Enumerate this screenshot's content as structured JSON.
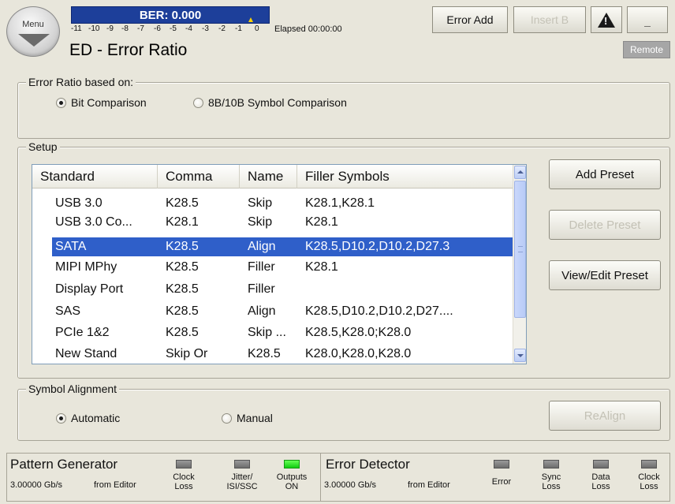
{
  "header": {
    "menu_label": "Menu",
    "ber_label": "BER: 0.000",
    "scale_ticks": [
      "-11",
      "-10",
      "-9",
      "-8",
      "-7",
      "-6",
      "-5",
      "-4",
      "-3",
      "-2",
      "-1",
      "0"
    ],
    "elapsed": "Elapsed 00:00:00",
    "title": "ED - Error Ratio",
    "error_add_label": "Error Add",
    "insert_b_label": "Insert B",
    "minimize_label": "_",
    "remote_label": "Remote",
    "warning_icon": "warning-icon"
  },
  "error_ratio": {
    "legend": "Error Ratio based on:",
    "options": [
      {
        "label": "Bit Comparison",
        "checked": true
      },
      {
        "label": "8B/10B Symbol Comparison",
        "checked": false
      }
    ]
  },
  "setup": {
    "legend": "Setup",
    "columns": [
      "Standard",
      "Comma",
      "Name",
      "Filler Symbols"
    ],
    "rows": [
      {
        "standard": "USB 3.0",
        "comma": "K28.5",
        "name": "Skip",
        "filler": "K28.1,K28.1",
        "selected": false
      },
      {
        "standard": "USB 3.0 Co...",
        "comma": "K28.1",
        "name": "Skip",
        "filler": "K28.1",
        "selected": false
      },
      {
        "standard": "SATA",
        "comma": "K28.5",
        "name": "Align",
        "filler": "K28.5,D10.2,D10.2,D27.3",
        "selected": true
      },
      {
        "standard": "MIPI MPhy",
        "comma": "K28.5",
        "name": "Filler",
        "filler": "K28.1",
        "selected": false
      },
      {
        "standard": "Display Port",
        "comma": "K28.5",
        "name": "Filler",
        "filler": "",
        "selected": false
      },
      {
        "standard": "SAS",
        "comma": "K28.5",
        "name": "Align",
        "filler": "K28.5,D10.2,D10.2,D27....",
        "selected": false
      },
      {
        "standard": "PCIe 1&2",
        "comma": "K28.5",
        "name": "Skip ...",
        "filler": "K28.5,K28.0;K28.0",
        "selected": false
      },
      {
        "standard": "New Stand",
        "comma": "Skip Or",
        "name": "K28.5",
        "filler": "K28.0,K28.0,K28.0",
        "selected": false
      }
    ],
    "add_preset": "Add Preset",
    "delete_preset": "Delete Preset",
    "view_edit_preset": "View/Edit Preset"
  },
  "symbol_alignment": {
    "legend": "Symbol Alignment",
    "options": [
      {
        "label": "Automatic",
        "checked": true
      },
      {
        "label": "Manual",
        "checked": false
      }
    ],
    "realign": "ReAlign"
  },
  "status": {
    "pattern_generator": {
      "title": "Pattern Generator",
      "rate": "3.00000 Gb/s",
      "source": "from Editor",
      "leds": [
        {
          "label1": "Clock",
          "label2": "Loss",
          "on": false
        },
        {
          "label1": "Jitter/",
          "label2": "ISI/SSC",
          "on": false
        },
        {
          "label1": "Outputs",
          "label2": "ON",
          "on": true
        }
      ]
    },
    "error_detector": {
      "title": "Error Detector",
      "rate": "3.00000 Gb/s",
      "source": "from Editor",
      "leds": [
        {
          "label1": "Error",
          "label2": "",
          "on": false
        },
        {
          "label1": "Sync",
          "label2": "Loss",
          "on": false
        },
        {
          "label1": "Data",
          "label2": "Loss",
          "on": false
        },
        {
          "label1": "Clock",
          "label2": "Loss",
          "on": false
        }
      ]
    }
  },
  "colors": {
    "ber_bg": "#1d3f9a",
    "selection": "#2f5fc9",
    "led_on": "#22dd22",
    "background": "#e8e6db"
  }
}
